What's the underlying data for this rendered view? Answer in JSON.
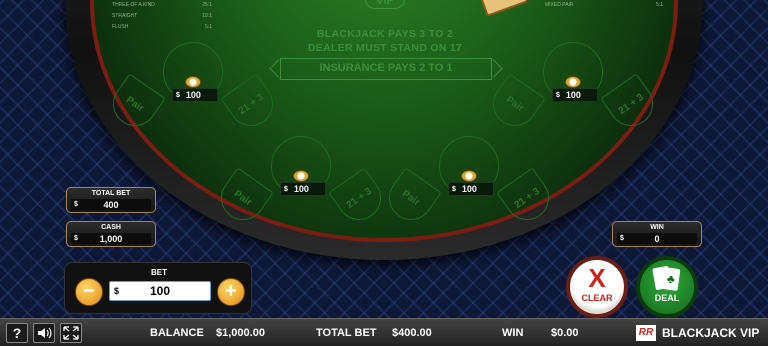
{
  "pay_table_left": [
    {
      "name": "THREE OF A KIND",
      "pay": "25:1"
    },
    {
      "name": "STRAIGHT",
      "pay": "10:1"
    },
    {
      "name": "FLUSH",
      "pay": "5:1"
    }
  ],
  "pay_table_right": [
    {
      "name": "MIXED PAIR",
      "pay": "5:1"
    }
  ],
  "table": {
    "title": "VIP",
    "line1": "BLACKJACK PAYS 3 TO 2",
    "line2": "DEALER MUST STAND ON 17",
    "insurance": "INSURANCE PAYS 2 TO 1"
  },
  "spots": [
    {
      "pair": "Pair",
      "side": "21 + 3",
      "currency": "$",
      "chip_value": "100"
    },
    {
      "pair": "Pair",
      "side": "21 + 3",
      "currency": "$",
      "chip_value": "100"
    },
    {
      "pair": "Pair",
      "side": "21 + 3",
      "currency": "$",
      "chip_value": "100"
    },
    {
      "pair": "Pair",
      "side": "21 + 3",
      "currency": "$",
      "chip_value": "100"
    }
  ],
  "total_bet_panel": {
    "title": "TOTAL BET",
    "currency": "$",
    "value": "400"
  },
  "cash_panel": {
    "title": "CASH",
    "currency": "$",
    "value": "1,000"
  },
  "win_panel": {
    "title": "WIN",
    "currency": "$",
    "value": "0"
  },
  "bet_control": {
    "title": "BET",
    "currency": "$",
    "value": "100",
    "minus": "−",
    "plus": "+"
  },
  "clear_button": {
    "glyph": "X",
    "label": "CLEAR"
  },
  "deal_button": {
    "suit": "♣",
    "label": "DEAL"
  },
  "bottom_bar": {
    "help": "?",
    "balance_label": "BALANCE",
    "balance_value": "$1,000.00",
    "total_bet_label": "TOTAL BET",
    "total_bet_value": "$400.00",
    "win_label": "WIN",
    "win_value": "$0.00",
    "logo": "RR",
    "brand": "BLACKJACK VIP"
  }
}
